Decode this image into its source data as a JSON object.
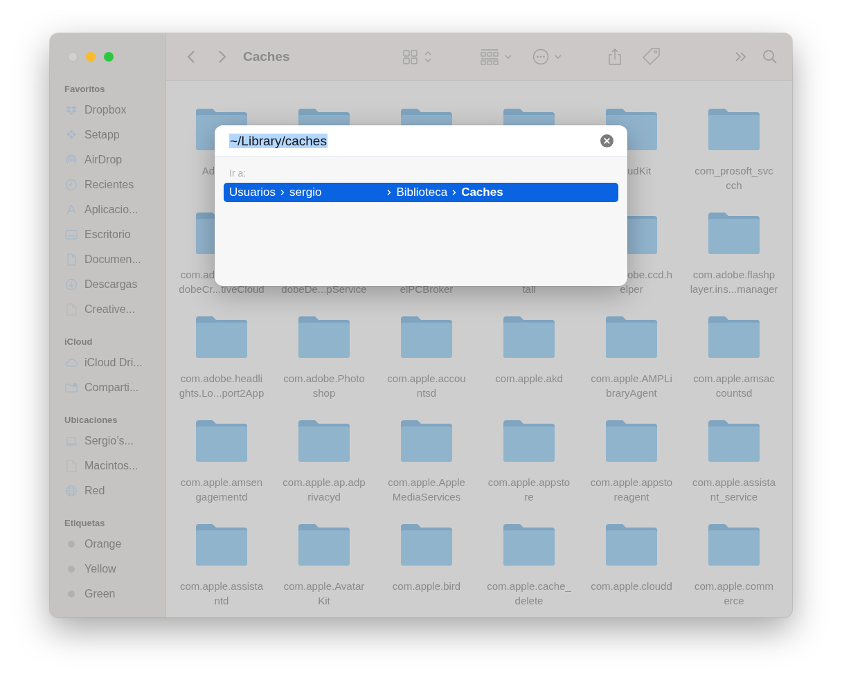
{
  "window": {
    "title": "Caches"
  },
  "sidebar": {
    "sections": [
      {
        "title": "Favoritos",
        "items": [
          {
            "label": "Dropbox",
            "kind": "dropbox"
          },
          {
            "label": "Setapp",
            "kind": "setapp"
          },
          {
            "label": "AirDrop",
            "kind": "airdrop"
          },
          {
            "label": "Recientes",
            "kind": "clock"
          },
          {
            "label": "Aplicacio...",
            "kind": "apps"
          },
          {
            "label": "Escritorio",
            "kind": "desktop"
          },
          {
            "label": "Documen...",
            "kind": "doc"
          },
          {
            "label": "Descargas",
            "kind": "download"
          },
          {
            "label": "Creative...",
            "kind": "file"
          }
        ]
      },
      {
        "title": "iCloud",
        "items": [
          {
            "label": "iCloud Dri...",
            "kind": "cloud"
          },
          {
            "label": "Comparti...",
            "kind": "shared"
          }
        ]
      },
      {
        "title": "Ubicaciones",
        "items": [
          {
            "label": "Sergio’s...",
            "kind": "laptop"
          },
          {
            "label": "Macintos...",
            "kind": "file"
          },
          {
            "label": "Red",
            "kind": "globe"
          }
        ]
      },
      {
        "title": "Etiquetas",
        "items": [
          {
            "label": "Orange",
            "kind": "tag"
          },
          {
            "label": "Yellow",
            "kind": "tag"
          },
          {
            "label": "Green",
            "kind": "tag"
          }
        ]
      }
    ]
  },
  "folders": [
    {
      "line_1": "Ad",
      "kind": "cut_end"
    },
    {
      "kind": "plain"
    },
    {
      "kind": "plain"
    },
    {
      "kind": "plain"
    },
    {
      "line_1": "udKit",
      "kind": "cut_start"
    },
    {
      "line_1": "com_prosoft_svc",
      "line_2": "cch",
      "kind": "plain"
    },
    {
      "line_1": "com.ad",
      "line_2": "dobeCr...tiveCloud",
      "kind": "cut_end"
    },
    {
      "line_2": "dobeDe...pService",
      "kind": "plain"
    },
    {
      "line_2": "elPCBroker",
      "kind": "plain"
    },
    {
      "line_2": "tall",
      "kind": "plain"
    },
    {
      "line_1": "obe.ccd.h",
      "line_2": "elper",
      "kind": "cut_start"
    },
    {
      "line_1": "com.adobe.flashp",
      "line_2": "layer.ins...manager",
      "kind": "plain"
    },
    {
      "line_1": "com.adobe.headli",
      "line_2": "ghts.Lo...port2App",
      "kind": "plain"
    },
    {
      "line_1": "com.adobe.Photo",
      "line_2": "shop",
      "kind": "plain"
    },
    {
      "line_1": "com.apple.accou",
      "line_2": "ntsd",
      "kind": "plain"
    },
    {
      "line_1": "com.apple.akd",
      "kind": "plain"
    },
    {
      "line_1": "com.apple.AMPLi",
      "line_2": "braryAgent",
      "kind": "plain"
    },
    {
      "line_1": "com.apple.amsac",
      "line_2": "countsd",
      "kind": "plain"
    },
    {
      "line_1": "com.apple.amsen",
      "line_2": "gagementd",
      "kind": "plain"
    },
    {
      "line_1": "com.apple.ap.adp",
      "line_2": "rivacyd",
      "kind": "plain"
    },
    {
      "line_1": "com.apple.Apple",
      "line_2": "MediaServices",
      "kind": "plain"
    },
    {
      "line_1": "com.apple.appsto",
      "line_2": "re",
      "kind": "plain"
    },
    {
      "line_1": "com.apple.appsto",
      "line_2": "reagent",
      "kind": "plain"
    },
    {
      "line_1": "com.apple.assista",
      "line_2": "nt_service",
      "kind": "plain"
    },
    {
      "line_1": "com.apple.assista",
      "line_2": "ntd",
      "kind": "plain"
    },
    {
      "line_1": "com.apple.Avatar",
      "line_2": "Kit",
      "kind": "plain"
    },
    {
      "line_1": "com.apple.bird",
      "kind": "plain"
    },
    {
      "line_1": "com.apple.cache_",
      "line_2": "delete",
      "kind": "plain"
    },
    {
      "line_1": "com.apple.cloudd",
      "kind": "plain"
    },
    {
      "line_1": "com.apple.comm",
      "line_2": "erce",
      "kind": "plain"
    }
  ],
  "dialog": {
    "field": {
      "value": "~/Library/caches",
      "selected": true
    },
    "hint": "Ir a:",
    "results": [
      {
        "selected": true,
        "path": [
          {
            "label": "Usuarios",
            "current": false
          },
          {
            "label": "sergio",
            "current": false
          },
          {
            "label": "Biblioteca",
            "current": false
          },
          {
            "label": "Caches",
            "current": true
          }
        ]
      }
    ]
  }
}
